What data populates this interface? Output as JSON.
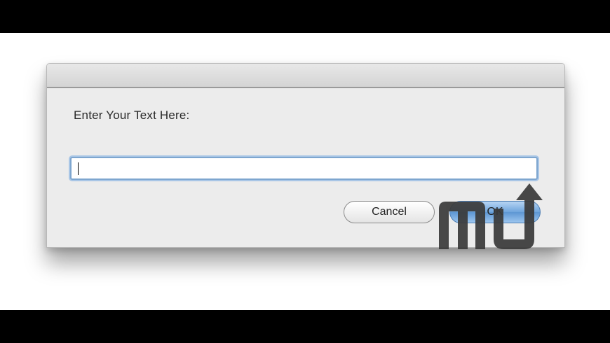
{
  "dialog": {
    "prompt": "Enter Your Text Here:",
    "input_value": "",
    "cancel_label": "Cancel",
    "ok_label": "OK"
  },
  "watermark": {
    "text": "mu"
  },
  "colors": {
    "dialog_bg": "#ececec",
    "focus_ring": "#7ea6cf",
    "default_button": "#6ea4dc",
    "watermark": "#3a3a3a"
  },
  "icons": [
    "text-caret"
  ]
}
